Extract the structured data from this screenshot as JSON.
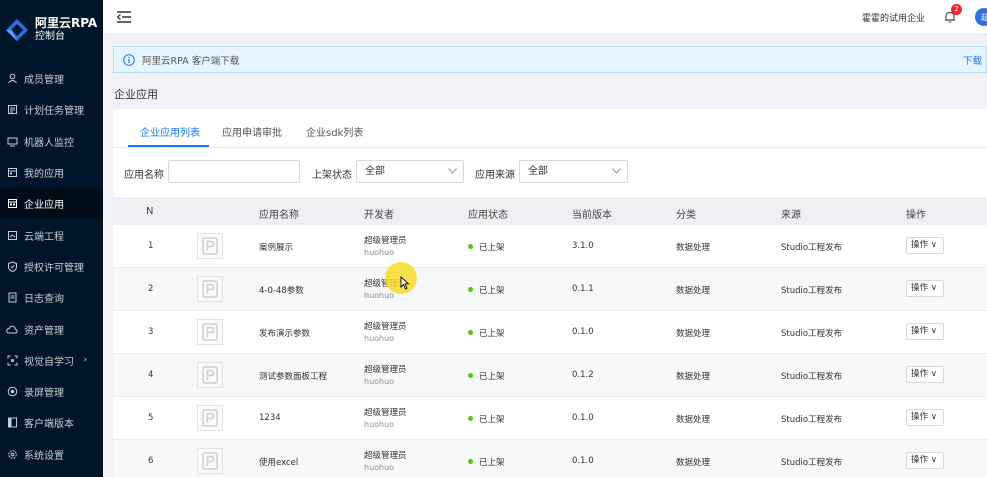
{
  "brand": {
    "title": "阿里云RPA",
    "subtitle": "控制台"
  },
  "sidebar": {
    "items": [
      {
        "label": "成员管理",
        "icon": "user-icon"
      },
      {
        "label": "计划任务管理",
        "icon": "calendar-icon"
      },
      {
        "label": "机器人监控",
        "icon": "monitor-icon"
      },
      {
        "label": "我的应用",
        "icon": "app-icon"
      },
      {
        "label": "企业应用",
        "icon": "enterprise-app-icon",
        "active": true
      },
      {
        "label": "云端工程",
        "icon": "cloud-project-icon"
      },
      {
        "label": "授权许可管理",
        "icon": "shield-icon"
      },
      {
        "label": "日志查询",
        "icon": "log-icon"
      },
      {
        "label": "资产管理",
        "icon": "cloud-icon"
      },
      {
        "label": "视觉自学习",
        "icon": "scan-icon",
        "has_children": true
      },
      {
        "label": "录屏管理",
        "icon": "record-icon"
      },
      {
        "label": "客户端版本",
        "icon": "book-icon"
      },
      {
        "label": "系统设置",
        "icon": "gear-icon"
      }
    ]
  },
  "header": {
    "org_name": "霍霍的试用企业",
    "notification_count": "2",
    "avatar_text": "超"
  },
  "notice": {
    "text": "阿里云RPA 客户端下载",
    "link": "下载"
  },
  "page_title": "企业应用",
  "tabs": [
    {
      "label": "企业应用列表",
      "active": true
    },
    {
      "label": "应用申请审批",
      "active": false
    },
    {
      "label": "企业sdk列表",
      "active": false
    }
  ],
  "filters": {
    "name_label": "应用名称",
    "name_value": "",
    "status_label": "上架状态",
    "status_value": "全部",
    "source_label": "应用来源",
    "source_value": "全部"
  },
  "table": {
    "columns": [
      "N",
      "应用名称",
      "开发者",
      "应用状态",
      "当前版本",
      "分类",
      "来源",
      "操作"
    ],
    "rows": [
      {
        "n": "1",
        "name": "案例展示",
        "developer": "超级管理员",
        "developer_sub": "huohuo",
        "status": "已上架",
        "version": "3.1.0",
        "category": "数据处理",
        "source": "Studio工程发布",
        "action": "操作"
      },
      {
        "n": "2",
        "name": "4-0-48参数",
        "developer": "超级管理员",
        "developer_sub": "huohuo",
        "status": "已上架",
        "version": "0.1.1",
        "category": "数据处理",
        "source": "Studio工程发布",
        "action": "操作"
      },
      {
        "n": "3",
        "name": "发布演示参数",
        "developer": "超级管理员",
        "developer_sub": "huohuo",
        "status": "已上架",
        "version": "0.1.0",
        "category": "数据处理",
        "source": "Studio工程发布",
        "action": "操作"
      },
      {
        "n": "4",
        "name": "测试参数面板工程",
        "developer": "超级管理员",
        "developer_sub": "huohuo",
        "status": "已上架",
        "version": "0.1.2",
        "category": "数据处理",
        "source": "Studio工程发布",
        "action": "操作"
      },
      {
        "n": "5",
        "name": "1234",
        "developer": "超级管理员",
        "developer_sub": "huohuo",
        "status": "已上架",
        "version": "0.1.0",
        "category": "数据处理",
        "source": "Studio工程发布",
        "action": "操作"
      },
      {
        "n": "6",
        "name": "使用excel",
        "developer": "超级管理员",
        "developer_sub": "huohuo",
        "status": "已上架",
        "version": "0.1.0",
        "category": "数据处理",
        "source": "Studio工程发布",
        "action": "操作"
      }
    ]
  },
  "colors": {
    "sidebar_bg": "#001529",
    "accent": "#1677ff",
    "status_green": "#52c41a",
    "badge_red": "#f5222d"
  }
}
